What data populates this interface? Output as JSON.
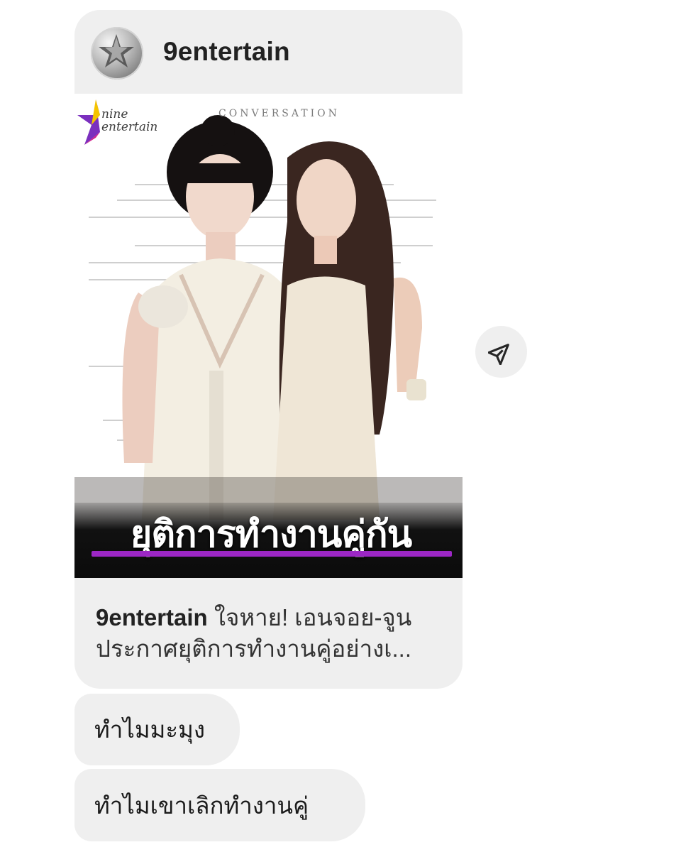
{
  "post": {
    "account": "9entertain",
    "image": {
      "brand_badge_line1": "nine",
      "brand_badge_line2": "entertain",
      "background_doc_title": "CONVERSATION",
      "headline": "ยุติการทำงานคู่กัน",
      "accent_color": "#9c27c5"
    },
    "caption": {
      "author": "9entertain",
      "text": "ใจหาย! เอนจอย-จูน ประกาศยุติการทำงานคู่อย่างเ..."
    }
  },
  "share": {
    "icon": "send-icon"
  },
  "messages": [
    {
      "text": "ทำไมมะมุง"
    },
    {
      "text": "ทำไมเขาเลิกทำงานคู่"
    }
  ]
}
